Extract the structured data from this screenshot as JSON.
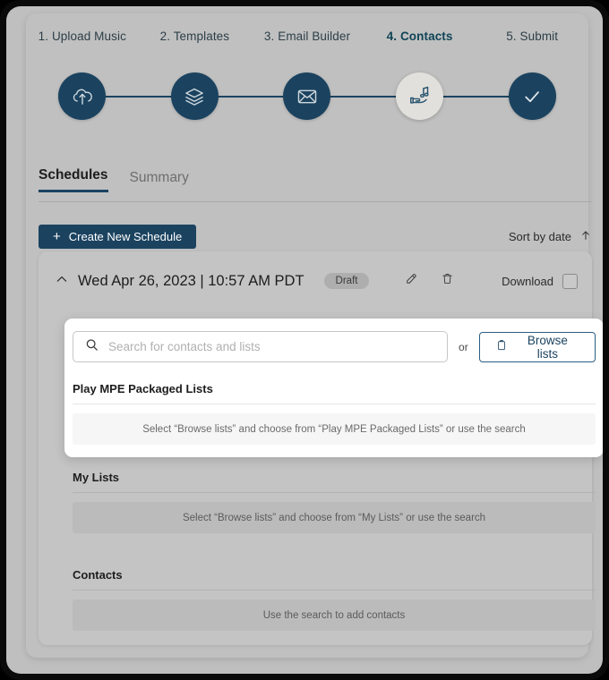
{
  "stepper": {
    "steps": [
      {
        "label": "1. Upload Music",
        "icon": "cloud-upload-icon",
        "state": "complete"
      },
      {
        "label": "2. Templates",
        "icon": "layers-icon",
        "state": "complete"
      },
      {
        "label": "3. Email Builder",
        "icon": "envelope-icon",
        "state": "complete"
      },
      {
        "label": "4. Contacts",
        "icon": "hand-music-note-icon",
        "state": "current"
      },
      {
        "label": "5. Submit",
        "icon": "check-icon",
        "state": "complete"
      }
    ]
  },
  "tabs": {
    "items": [
      {
        "label": "Schedules",
        "active": true
      },
      {
        "label": "Summary",
        "active": false
      }
    ]
  },
  "toolbar": {
    "create_label": "Create New Schedule",
    "create_plus": "+",
    "sort_label": "Sort by date",
    "sort_icon": "arrow-up-icon"
  },
  "schedule": {
    "chevron_icon": "chevron-up-icon",
    "title": "Wed Apr 26, 2023 | 10:57 AM PDT",
    "status_badge": "Draft",
    "edit_icon": "edit-pencil-icon",
    "delete_icon": "trash-icon",
    "download_label": "Download",
    "download_checked": false
  },
  "search": {
    "icon": "search-icon",
    "placeholder": "Search for contacts and lists",
    "value": "",
    "or_text": "or",
    "browse_label": "Browse lists",
    "browse_icon": "clipboard-icon"
  },
  "sections": [
    {
      "title": "Play MPE Packaged Lists",
      "empty_text": "Select “Browse lists” and choose from “Play MPE Packaged Lists” or use the search"
    },
    {
      "title": "My Lists",
      "empty_text": "Select “Browse lists” and choose from “My Lists” or use the search"
    },
    {
      "title": "Contacts",
      "empty_text": "Use the search to add contacts"
    }
  ],
  "colors": {
    "brand_dark": "#1b4360",
    "brand_accent": "#0f4456",
    "page_bg": "#bfbfbf",
    "card_bg": "#c4c4c4",
    "panel_bg": "#ffffff",
    "badge_bg": "#aeaeae"
  }
}
